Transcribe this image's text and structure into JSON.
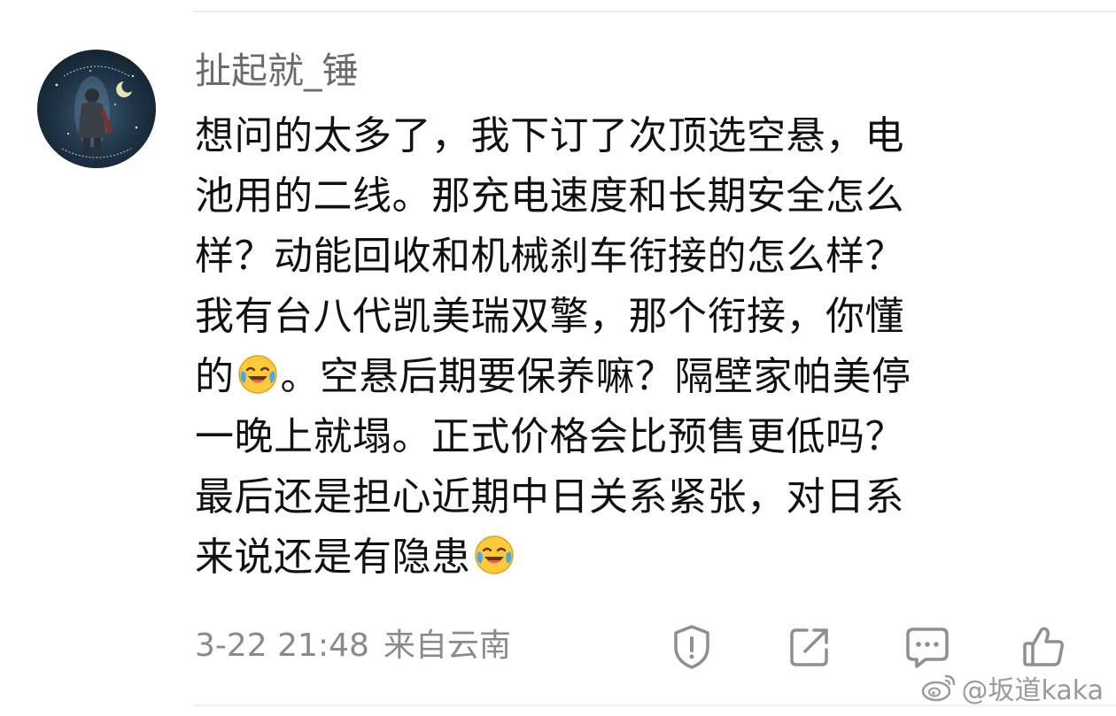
{
  "comment": {
    "username": "扯起就_锤",
    "content_lines": [
      "想问的太多了，我下订了次顶选空悬，电",
      "池用的二线。那充电速度和长期安全怎么",
      "样？动能回收和机械刹车衔接的怎么样？",
      "我有台八代凯美瑞双擎，那个衔接，你懂",
      {
        "before": "的",
        "after": "。空悬后期要保养嘛？隔壁家帕美停"
      },
      "一晚上就塌。正式价格会比预售更低吗？",
      "最后还是担心近期中日关系紧张，对日系",
      {
        "before": "来说还是有隐患",
        "after": ""
      }
    ],
    "emoji_name": "laugh-cry-emoji",
    "timestamp": "3-22 21:48",
    "location": "来自云南"
  },
  "actions": {
    "report_icon": "report-icon",
    "share_icon": "share-icon",
    "comment_icon": "comment-icon",
    "like_icon": "thumbs-up-icon"
  },
  "watermark": {
    "icon": "weibo-icon",
    "text": "@坂道kaka"
  },
  "colors": {
    "username": "#6b6b6b",
    "text": "#111111",
    "meta": "#8a8a8a",
    "icon": "#8f8f8f",
    "emoji_face": "#ffc93c",
    "emoji_tears": "#4aa8e8"
  }
}
